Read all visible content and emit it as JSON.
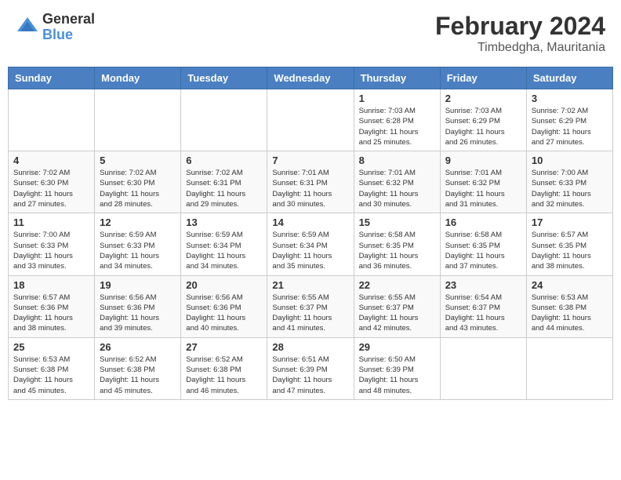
{
  "header": {
    "logo_general": "General",
    "logo_blue": "Blue",
    "month_year": "February 2024",
    "location": "Timbedgha, Mauritania"
  },
  "days_of_week": [
    "Sunday",
    "Monday",
    "Tuesday",
    "Wednesday",
    "Thursday",
    "Friday",
    "Saturday"
  ],
  "weeks": [
    [
      {
        "day": "",
        "info": ""
      },
      {
        "day": "",
        "info": ""
      },
      {
        "day": "",
        "info": ""
      },
      {
        "day": "",
        "info": ""
      },
      {
        "day": "1",
        "info": "Sunrise: 7:03 AM\nSunset: 6:28 PM\nDaylight: 11 hours\nand 25 minutes."
      },
      {
        "day": "2",
        "info": "Sunrise: 7:03 AM\nSunset: 6:29 PM\nDaylight: 11 hours\nand 26 minutes."
      },
      {
        "day": "3",
        "info": "Sunrise: 7:02 AM\nSunset: 6:29 PM\nDaylight: 11 hours\nand 27 minutes."
      }
    ],
    [
      {
        "day": "4",
        "info": "Sunrise: 7:02 AM\nSunset: 6:30 PM\nDaylight: 11 hours\nand 27 minutes."
      },
      {
        "day": "5",
        "info": "Sunrise: 7:02 AM\nSunset: 6:30 PM\nDaylight: 11 hours\nand 28 minutes."
      },
      {
        "day": "6",
        "info": "Sunrise: 7:02 AM\nSunset: 6:31 PM\nDaylight: 11 hours\nand 29 minutes."
      },
      {
        "day": "7",
        "info": "Sunrise: 7:01 AM\nSunset: 6:31 PM\nDaylight: 11 hours\nand 30 minutes."
      },
      {
        "day": "8",
        "info": "Sunrise: 7:01 AM\nSunset: 6:32 PM\nDaylight: 11 hours\nand 30 minutes."
      },
      {
        "day": "9",
        "info": "Sunrise: 7:01 AM\nSunset: 6:32 PM\nDaylight: 11 hours\nand 31 minutes."
      },
      {
        "day": "10",
        "info": "Sunrise: 7:00 AM\nSunset: 6:33 PM\nDaylight: 11 hours\nand 32 minutes."
      }
    ],
    [
      {
        "day": "11",
        "info": "Sunrise: 7:00 AM\nSunset: 6:33 PM\nDaylight: 11 hours\nand 33 minutes."
      },
      {
        "day": "12",
        "info": "Sunrise: 6:59 AM\nSunset: 6:33 PM\nDaylight: 11 hours\nand 34 minutes."
      },
      {
        "day": "13",
        "info": "Sunrise: 6:59 AM\nSunset: 6:34 PM\nDaylight: 11 hours\nand 34 minutes."
      },
      {
        "day": "14",
        "info": "Sunrise: 6:59 AM\nSunset: 6:34 PM\nDaylight: 11 hours\nand 35 minutes."
      },
      {
        "day": "15",
        "info": "Sunrise: 6:58 AM\nSunset: 6:35 PM\nDaylight: 11 hours\nand 36 minutes."
      },
      {
        "day": "16",
        "info": "Sunrise: 6:58 AM\nSunset: 6:35 PM\nDaylight: 11 hours\nand 37 minutes."
      },
      {
        "day": "17",
        "info": "Sunrise: 6:57 AM\nSunset: 6:35 PM\nDaylight: 11 hours\nand 38 minutes."
      }
    ],
    [
      {
        "day": "18",
        "info": "Sunrise: 6:57 AM\nSunset: 6:36 PM\nDaylight: 11 hours\nand 38 minutes."
      },
      {
        "day": "19",
        "info": "Sunrise: 6:56 AM\nSunset: 6:36 PM\nDaylight: 11 hours\nand 39 minutes."
      },
      {
        "day": "20",
        "info": "Sunrise: 6:56 AM\nSunset: 6:36 PM\nDaylight: 11 hours\nand 40 minutes."
      },
      {
        "day": "21",
        "info": "Sunrise: 6:55 AM\nSunset: 6:37 PM\nDaylight: 11 hours\nand 41 minutes."
      },
      {
        "day": "22",
        "info": "Sunrise: 6:55 AM\nSunset: 6:37 PM\nDaylight: 11 hours\nand 42 minutes."
      },
      {
        "day": "23",
        "info": "Sunrise: 6:54 AM\nSunset: 6:37 PM\nDaylight: 11 hours\nand 43 minutes."
      },
      {
        "day": "24",
        "info": "Sunrise: 6:53 AM\nSunset: 6:38 PM\nDaylight: 11 hours\nand 44 minutes."
      }
    ],
    [
      {
        "day": "25",
        "info": "Sunrise: 6:53 AM\nSunset: 6:38 PM\nDaylight: 11 hours\nand 45 minutes."
      },
      {
        "day": "26",
        "info": "Sunrise: 6:52 AM\nSunset: 6:38 PM\nDaylight: 11 hours\nand 45 minutes."
      },
      {
        "day": "27",
        "info": "Sunrise: 6:52 AM\nSunset: 6:38 PM\nDaylight: 11 hours\nand 46 minutes."
      },
      {
        "day": "28",
        "info": "Sunrise: 6:51 AM\nSunset: 6:39 PM\nDaylight: 11 hours\nand 47 minutes."
      },
      {
        "day": "29",
        "info": "Sunrise: 6:50 AM\nSunset: 6:39 PM\nDaylight: 11 hours\nand 48 minutes."
      },
      {
        "day": "",
        "info": ""
      },
      {
        "day": "",
        "info": ""
      }
    ]
  ]
}
